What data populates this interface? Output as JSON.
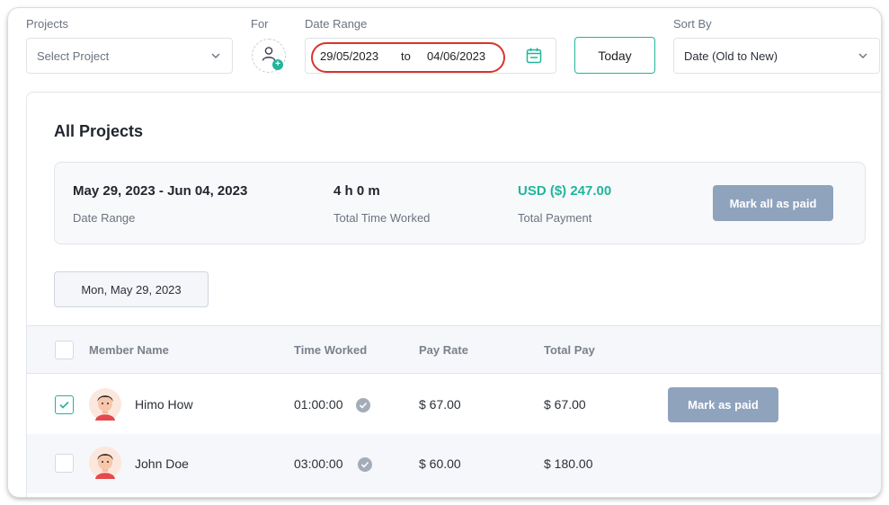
{
  "filters": {
    "projects_label": "Projects",
    "projects_placeholder": "Select Project",
    "for_label": "For",
    "date_range_label": "Date Range",
    "date_from": "29/05/2023",
    "date_to_word": "to",
    "date_to": "04/06/2023",
    "today_label": "Today",
    "sort_by_label": "Sort By",
    "sort_by_value": "Date (Old to New)"
  },
  "panel": {
    "title": "All Projects",
    "summary": {
      "date_range_value": "May 29, 2023 - Jun 04, 2023",
      "date_range_label": "Date Range",
      "time_value": "4 h 0 m",
      "time_label": "Total Time Worked",
      "payment_value": "USD ($) 247.00",
      "payment_label": "Total Payment",
      "mark_all_label": "Mark all as paid"
    },
    "day_chip": "Mon, May 29, 2023"
  },
  "table": {
    "columns": [
      "Member Name",
      "Time Worked",
      "Pay Rate",
      "Total Pay"
    ],
    "rows": [
      {
        "name": "Himo How",
        "time": "01:00:00",
        "rate": "$ 67.00",
        "total": "$ 67.00",
        "checked": true,
        "action": "Mark as paid"
      },
      {
        "name": "John Doe",
        "time": "03:00:00",
        "rate": "$ 60.00",
        "total": "$ 180.00",
        "checked": false
      }
    ]
  },
  "colors": {
    "accent": "#22b59a",
    "highlight_circle": "#d8342c",
    "muted_button": "#8fa3bd"
  },
  "icons": [
    "chevron-down-icon",
    "add-member-icon",
    "calendar-icon",
    "verified-check-icon",
    "member-avatar-icon"
  ]
}
